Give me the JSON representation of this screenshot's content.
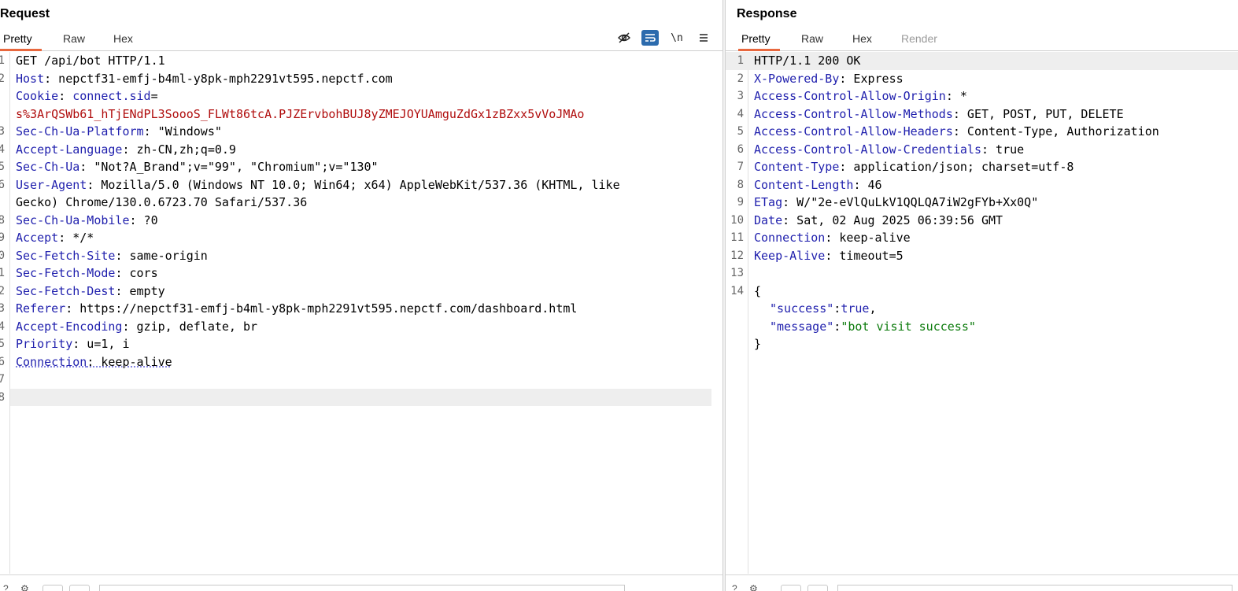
{
  "request": {
    "title": "Request",
    "tabs": [
      "Pretty",
      "Raw",
      "Hex"
    ],
    "toolbar": {
      "hide_icon": "eye-off-icon",
      "wrap_icon": "word-wrap-icon",
      "newline_label": "\\n",
      "menu_icon": "menu-icon"
    },
    "line_numbers": [
      "1",
      "2",
      "",
      "3",
      "4",
      "5",
      "6",
      "7",
      "",
      "8",
      "9",
      "0",
      "1",
      "2",
      "3",
      "4",
      "5",
      "6",
      "7",
      "8"
    ],
    "lines": {
      "l1": "GET /api/bot HTTP/1.1",
      "l2_key": "Host",
      "l2_val": ": nepctf31-emfj-b4ml-y8pk-mph2291vt595.nepctf.com",
      "l3_key": "Cookie",
      "l3_sep": ": ",
      "l3_name": "connect.sid",
      "l3_eq": "=",
      "l3_cont": "s%3ArQSWb61_hTjENdPL3SoooS_FLWt86tcA.PJZErvbohBUJ8yZMEJOYUAmguZdGx1zBZxx5vVoJMAo",
      "l4_key": "Sec-Ch-Ua-Platform",
      "l4_val": ": \"Windows\"",
      "l5_key": "Accept-Language",
      "l5_val": ": zh-CN,zh;q=0.9",
      "l6_key": "Sec-Ch-Ua",
      "l6_val": ": \"Not?A_Brand\";v=\"99\", \"Chromium\";v=\"130\"",
      "l7_key": "User-Agent",
      "l7_val": ": Mozilla/5.0 (Windows NT 10.0; Win64; x64) AppleWebKit/537.36 (KHTML, like",
      "l7_cont": "Gecko) Chrome/130.0.6723.70 Safari/537.36",
      "l8_key": "Sec-Ch-Ua-Mobile",
      "l8_val": ": ?0",
      "l9_key": "Accept",
      "l9_val": ": */*",
      "l10_key": "Sec-Fetch-Site",
      "l10_val": ": same-origin",
      "l11_key": "Sec-Fetch-Mode",
      "l11_val": ": cors",
      "l12_key": "Sec-Fetch-Dest",
      "l12_val": ": empty",
      "l13_key": "Referer",
      "l13_val": ": https://nepctf31-emfj-b4ml-y8pk-mph2291vt595.nepctf.com/dashboard.html",
      "l14_key": "Accept-Encoding",
      "l14_val": ": gzip, deflate, br",
      "l15_key": "Priority",
      "l15_val": ": u=1, i",
      "l16_key": "Connection",
      "l16_val": ": keep-alive"
    }
  },
  "response": {
    "title": "Response",
    "tabs": [
      "Pretty",
      "Raw",
      "Hex",
      "Render"
    ],
    "line_numbers": [
      "1",
      "2",
      "3",
      "4",
      "5",
      "6",
      "7",
      "8",
      "9",
      "10",
      "11",
      "12",
      "13",
      "14"
    ],
    "lines": {
      "l1": "HTTP/1.1 200 OK",
      "l2_key": "X-Powered-By",
      "l2_val": ": Express",
      "l3_key": "Access-Control-Allow-Origin",
      "l3_val": ": *",
      "l4_key": "Access-Control-Allow-Methods",
      "l4_val": ": GET, POST, PUT, DELETE",
      "l5_key": "Access-Control-Allow-Headers",
      "l5_val": ": Content-Type, Authorization",
      "l6_key": "Access-Control-Allow-Credentials",
      "l6_val": ": true",
      "l7_key": "Content-Type",
      "l7_val": ": application/json; charset=utf-8",
      "l8_key": "Content-Length",
      "l8_val": ": 46",
      "l9_key": "ETag",
      "l9_val": ": W/\"2e-eVlQuLkV1QQLQA7iW2gFYb+Xx0Q\"",
      "l10_key": "Date",
      "l10_val": ": Sat, 02 Aug 2025 06:39:56 GMT",
      "l11_key": "Connection",
      "l11_val": ": keep-alive",
      "l12_key": "Keep-Alive",
      "l12_val": ": timeout=5",
      "body_open": "{",
      "body_k1": "\"success\"",
      "body_sep1": ":",
      "body_v1": "true",
      "body_comma1": ",",
      "body_k2": "\"message\"",
      "body_sep2": ":",
      "body_v2": "\"bot visit success\"",
      "body_close": "}"
    }
  },
  "colors": {
    "key": "#1f1fad",
    "cookie_value": "#b00d0d",
    "json_string": "#0a7a0a",
    "active_tab_underline": "#e8683e",
    "toggle_active": "#2c6bad"
  }
}
